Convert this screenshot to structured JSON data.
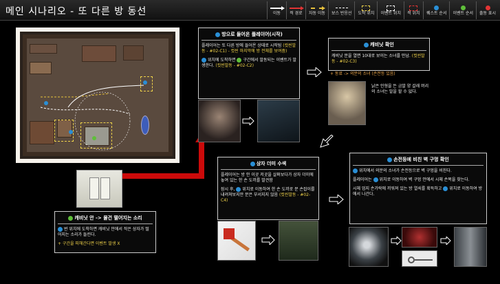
{
  "header": {
    "title": "메인 시나리오 - 또 다른 방 동선",
    "legend": [
      {
        "label": "이동",
        "kind": "line",
        "color": "#ffffff"
      },
      {
        "label": "적 경로",
        "kind": "line",
        "color": "#e23434"
      },
      {
        "label": "자동 이동",
        "kind": "line",
        "color": "#e7c13c"
      },
      {
        "label": "보스 반응선",
        "kind": "line",
        "color": "#ffffff"
      },
      {
        "label": "도착 위치",
        "kind": "box",
        "color": "#f0d24a"
      },
      {
        "label": "이벤트 위치",
        "kind": "box",
        "color": "#ffffff"
      },
      {
        "label": "적 위치",
        "kind": "box",
        "color": "#e23434"
      },
      {
        "label": "퀘스트 순서",
        "kind": "dot",
        "color": "#2a8fd6"
      },
      {
        "label": "이벤트 순서",
        "kind": "dot",
        "color": "#5fbf3a"
      },
      {
        "label": "출동 표시",
        "kind": "dot",
        "color": "#e23434"
      }
    ]
  },
  "cards": {
    "c1": {
      "title": "방으로 들어온 플레이어(시작)",
      "p1a": "플레이어는 또 다른 방에 들어온 상태로 시작됨",
      "p1b": "(컷씬발동 - #02-C1) - 컷씬 마지막에 방 전체를 보여줌)",
      "p2a": "위치에 도착하면",
      "p2b": "구간에서 발동되는 이벤트가 발생한다.",
      "p2c": "(컷씬발동 - #02-C2)"
    },
    "c2": {
      "title": "캐비닛 확인",
      "p1a": "캐비닛 문을 열면 10대로 보이는 소녀를 만남.",
      "p1b": "(컷씬발동 - #02-C3)",
      "p2": "+ 동료 -> 의문의 소녀 (손전등 있음)",
      "side": "낡은 인형을 든 금발 양 갈래 머리의 소녀는 말을 할 수 없다."
    },
    "c3": {
      "title": "캐비닛 안 -> 물건 떨어지는 소리",
      "p1": "번 위치에 도착하면 캐비닛 안에서 작은 상자가 떨어지는 소리가 들린다.",
      "p2": "+ 구간을 피해간다면 이벤트 발생 X"
    },
    "c4": {
      "title": "상자 더미 수색",
      "p1": "플레이어는 방 안 이곳 저곳을 살펴보다가 상자 더미에 놓여 있는 한 손 도끼를 발견함",
      "p2a": "잠시 후,",
      "p2b": "위치로 이동하여 한 손 도끼로 문 손잡이를 내려쳐보지만 문은 부서지지 않음",
      "p2c": "(컷씬발동 - #02-C4)"
    },
    "c5": {
      "title": "손전등에 비친 벽 구멍 확인",
      "p1": "위치에서 의문의 소녀가 손전등으로 벽 구멍을 비친다.",
      "p2a": "플레이어는",
      "p2b": "위치로 이동하여 벽 구멍 안에서 시체 손목을 찾는다.",
      "p3a": "시체 엄지 손가락에 끼워져 있는 방 열쇠를 획득하고",
      "p3b": "위치로 이동하여 방에서 나간다."
    }
  }
}
